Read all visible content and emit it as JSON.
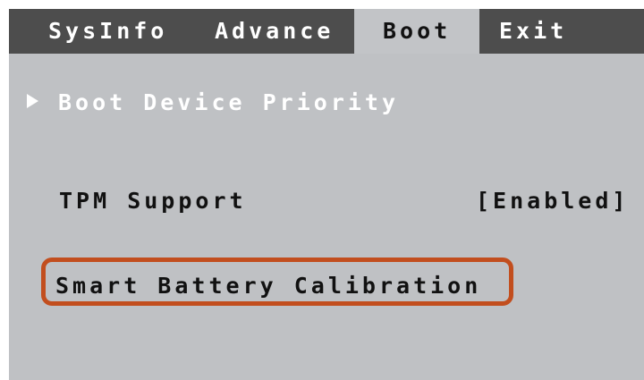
{
  "menu": {
    "tabs": [
      {
        "label": "SysInfo",
        "active": false
      },
      {
        "label": "Advance",
        "active": false
      },
      {
        "label": "Boot",
        "active": true
      },
      {
        "label": "Exit",
        "active": false
      }
    ]
  },
  "boot": {
    "items": [
      {
        "label": "Boot Device Priority",
        "icon": "submenu-arrow-icon"
      },
      {
        "label": "TPM Support",
        "value": "[Enabled]"
      },
      {
        "label": "Smart Battery Calibration"
      }
    ]
  },
  "colors": {
    "menubar": "#4d4d4d",
    "background": "#bfc1c4",
    "highlight": "#c24e1e"
  }
}
